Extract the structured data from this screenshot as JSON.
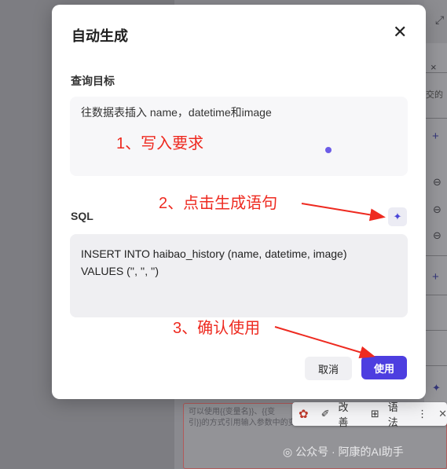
{
  "modal": {
    "title": "自动生成",
    "goal_label": "查询目标",
    "goal_text": "往数据表插入 name，datetime和image",
    "sql_label": "SQL",
    "sql_text": "INSERT INTO haibao_history (name, datetime, image)\nVALUES ('', '', '')",
    "cancel_label": "取消",
    "use_label": "使用"
  },
  "annotations": {
    "step1": "1、写入要求",
    "step2": "2、点击生成语句",
    "step3": "3、确认使用"
  },
  "background": {
    "right_hint": "交的",
    "textarea_hint": "可以使用{{变量名}}、{{变\n引}}的方式引用输入参数中的变量",
    "grammar_bar": {
      "improve": "改善",
      "grammar": "语法"
    },
    "watermark": "公众号 · 阿康的AI助手"
  },
  "colors": {
    "primary": "#4d3ee0",
    "annotation": "#ee2a20"
  }
}
